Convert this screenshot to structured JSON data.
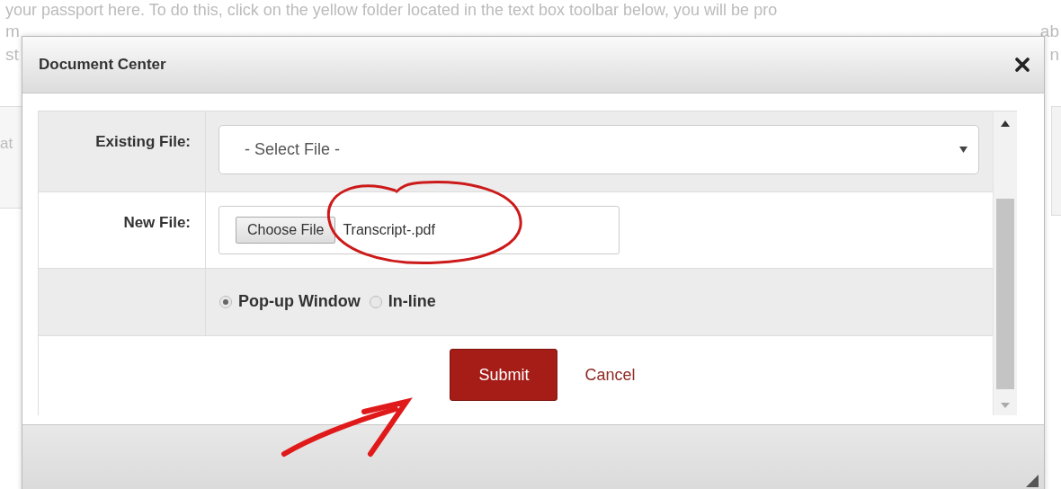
{
  "background": {
    "top_line": "your passport here. To do this, click on the yellow folder located in the text box toolbar below, you will be pro",
    "left_fragments": [
      "m",
      "st"
    ],
    "right_fragments": [
      "ab",
      "n"
    ],
    "panel_fragment": "at"
  },
  "dialog": {
    "title": "Document Center",
    "fields": [
      {
        "kind": "select",
        "label": "Existing File:",
        "placeholder": "- Select File -"
      },
      {
        "kind": "file",
        "label": "New File:",
        "button": "Choose File",
        "value": "Transcript-.pdf"
      },
      {
        "kind": "radios",
        "options": [
          {
            "label": "Pop-up Window",
            "selected": true
          },
          {
            "label": "In-line",
            "selected": false
          }
        ]
      }
    ],
    "submit": "Submit",
    "cancel": "Cancel"
  }
}
